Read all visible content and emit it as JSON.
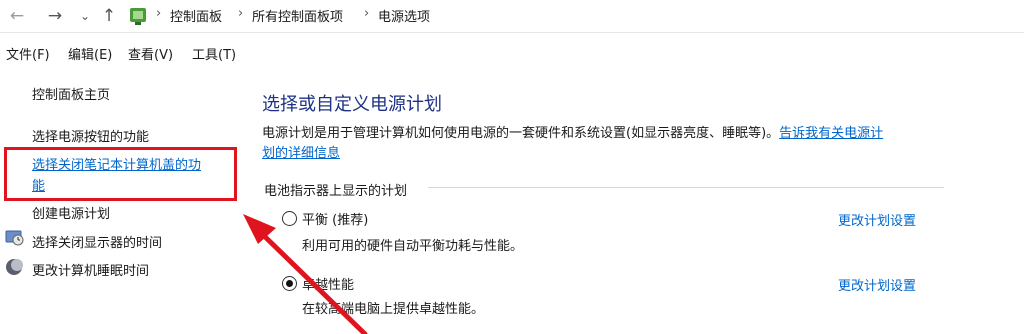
{
  "address_bar": {
    "breadcrumbs": [
      "控制面板",
      "所有控制面板项",
      "电源选项"
    ]
  },
  "menu": [
    "文件(F)",
    "编辑(E)",
    "查看(V)",
    "工具(T)"
  ],
  "left_pane": {
    "home": "控制面板主页",
    "links": [
      {
        "label": "选择电源按钮的功能"
      },
      {
        "label_line1": "选择关闭笔记本计算机盖的功",
        "label_line2": "能"
      },
      {
        "label": "创建电源计划"
      },
      {
        "label": "选择关闭显示器的时间",
        "icon": "monitor-clock-icon"
      },
      {
        "label": "更改计算机睡眠时间",
        "icon": "moon-icon"
      }
    ]
  },
  "main": {
    "title": "选择或自定义电源计划",
    "description_text": "电源计划是用于管理计算机如何使用电源的一套硬件和系统设置(如显示器亮度、睡眠等)。",
    "description_link_line1": "告诉我有关电源计",
    "description_link_line2": "划的详细信息",
    "group_label": "电池指示器上显示的计划",
    "plans": [
      {
        "name": "平衡 (推荐)",
        "description": "利用可用的硬件自动平衡功耗与性能。",
        "selected": false,
        "change_label": "更改计划设置"
      },
      {
        "name": "卓越性能",
        "description": "在较高端电脑上提供卓越性能。",
        "selected": true,
        "change_label": "更改计划设置"
      }
    ]
  },
  "colors": {
    "title": "#1e3287",
    "link": "#0066cc",
    "highlight_box": "#e0141e",
    "arrow": "#e0141e"
  }
}
